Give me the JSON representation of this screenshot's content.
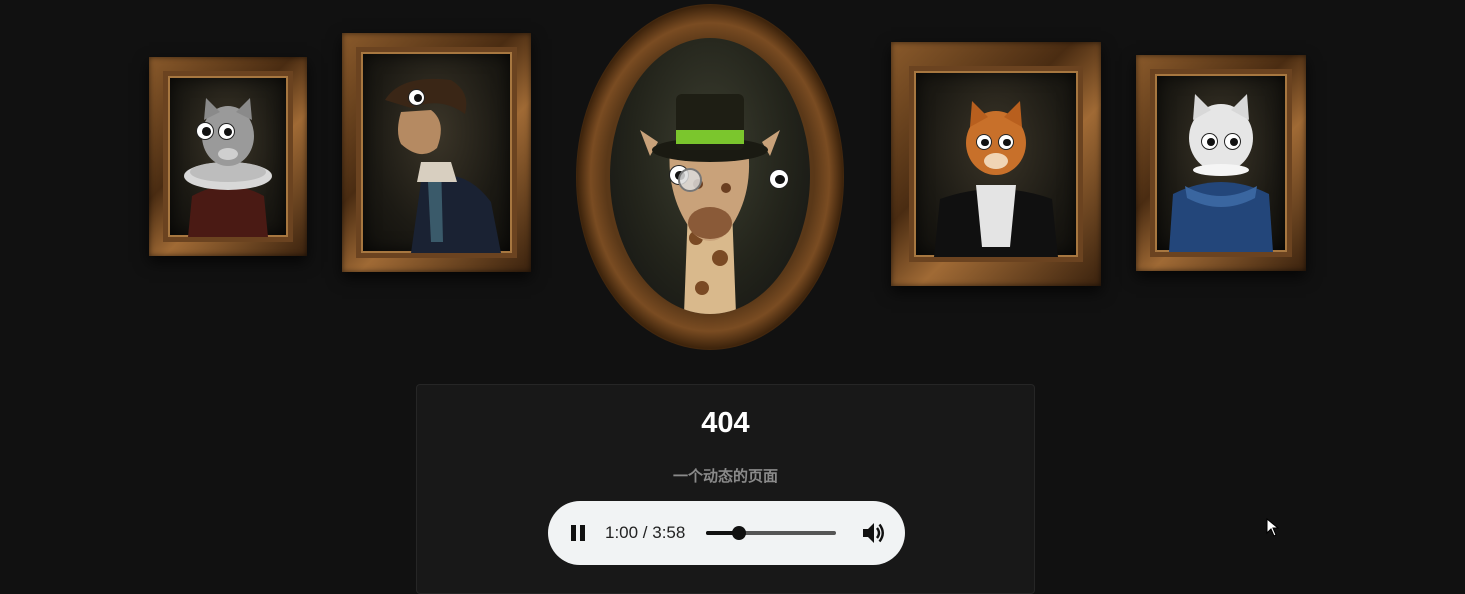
{
  "error": {
    "code": "404",
    "subtitle": "一个动态的页面"
  },
  "audio_player": {
    "time_display": "1:00 / 3:58",
    "progress_fraction": 0.25,
    "state": "playing",
    "icons": {
      "pause": "pause-icon",
      "volume": "volume-icon"
    }
  },
  "gallery": {
    "portraits": [
      {
        "subject": "gray-cat",
        "frame": "rectangular"
      },
      {
        "subject": "ferret-in-bicorne",
        "frame": "rectangular"
      },
      {
        "subject": "giraffe-in-top-hat",
        "frame": "oval-ornate"
      },
      {
        "subject": "orange-cat",
        "frame": "rectangular"
      },
      {
        "subject": "white-cat",
        "frame": "rectangular"
      }
    ]
  },
  "colors": {
    "background": "#111111",
    "card": "#181818",
    "player": "#f1f3f4",
    "hat_band": "#7bc62d"
  }
}
